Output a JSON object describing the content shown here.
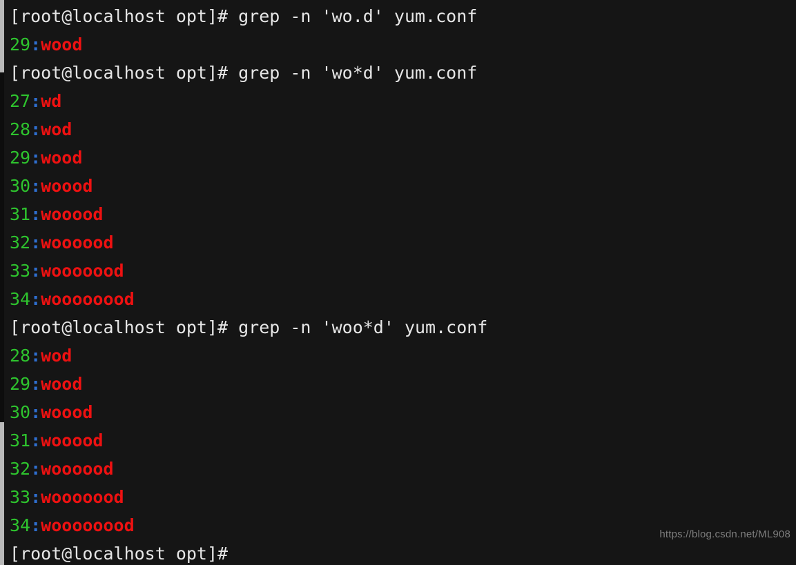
{
  "terminal": {
    "background_color": "#151515",
    "prompt_color": "#e6e6e6",
    "lineno_color": "#2ec42e",
    "separator_color": "#2f6fd0",
    "match_color": "#ee1111",
    "separator": ":",
    "lines": [
      {
        "type": "prompt",
        "text": "[root@localhost opt]# grep -n 'wo.d' yum.conf"
      },
      {
        "type": "result",
        "lineno": "29",
        "text": "wood"
      },
      {
        "type": "prompt",
        "text": "[root@localhost opt]# grep -n 'wo*d' yum.conf"
      },
      {
        "type": "result",
        "lineno": "27",
        "text": "wd"
      },
      {
        "type": "result",
        "lineno": "28",
        "text": "wod"
      },
      {
        "type": "result",
        "lineno": "29",
        "text": "wood"
      },
      {
        "type": "result",
        "lineno": "30",
        "text": "woood"
      },
      {
        "type": "result",
        "lineno": "31",
        "text": "wooood"
      },
      {
        "type": "result",
        "lineno": "32",
        "text": "woooood"
      },
      {
        "type": "result",
        "lineno": "33",
        "text": "wooooood"
      },
      {
        "type": "result",
        "lineno": "34",
        "text": "woooooood"
      },
      {
        "type": "prompt",
        "text": "[root@localhost opt]# grep -n 'woo*d' yum.conf"
      },
      {
        "type": "result",
        "lineno": "28",
        "text": "wod"
      },
      {
        "type": "result",
        "lineno": "29",
        "text": "wood"
      },
      {
        "type": "result",
        "lineno": "30",
        "text": "woood"
      },
      {
        "type": "result",
        "lineno": "31",
        "text": "wooood"
      },
      {
        "type": "result",
        "lineno": "32",
        "text": "woooood"
      },
      {
        "type": "result",
        "lineno": "33",
        "text": "wooooood"
      },
      {
        "type": "result",
        "lineno": "34",
        "text": "woooooood"
      },
      {
        "type": "prompt",
        "text": "[root@localhost opt]#"
      }
    ]
  },
  "watermark": {
    "text": "https://blog.csdn.net/ML908"
  }
}
